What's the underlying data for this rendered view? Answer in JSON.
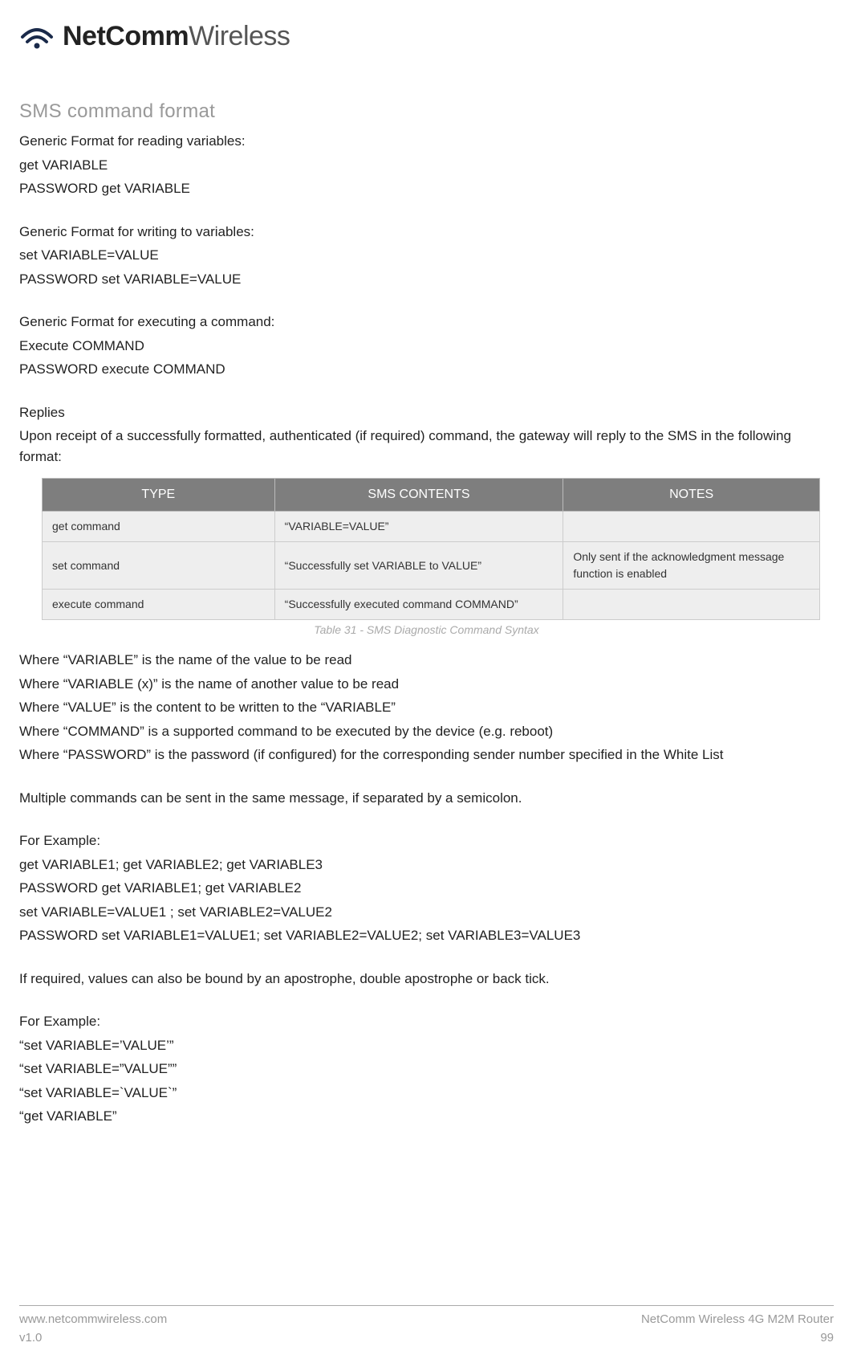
{
  "brand": {
    "bold": "NetComm",
    "thin": "Wireless"
  },
  "heading": "SMS command format",
  "read_intro": "Generic Format for reading variables:",
  "read_1": "get VARIABLE",
  "read_2": "PASSWORD get VARIABLE",
  "write_intro": "Generic Format for writing to variables:",
  "write_1": "set VARIABLE=VALUE",
  "write_2": "PASSWORD set VARIABLE=VALUE",
  "exec_intro": "Generic Format for executing a command:",
  "exec_1": "Execute COMMAND",
  "exec_2": "PASSWORD execute COMMAND",
  "replies_h": "Replies",
  "replies_body": "Upon receipt of a successfully formatted, authenticated (if required) command, the gateway will reply to the SMS in the following format:",
  "table": {
    "headers": [
      "TYPE",
      "SMS CONTENTS",
      "NOTES"
    ],
    "rows": [
      {
        "type": "get command",
        "contents": "“VARIABLE=VALUE”",
        "notes": ""
      },
      {
        "type": "set command",
        "contents": "“Successfully set VARIABLE to VALUE”",
        "notes": "Only sent if the acknowledgment message function is enabled"
      },
      {
        "type": "execute command",
        "contents": "“Successfully executed command COMMAND”",
        "notes": ""
      }
    ],
    "caption": "Table 31 - SMS Diagnostic Command Syntax"
  },
  "where": [
    "Where “VARIABLE” is the name of the value to be read",
    "Where “VARIABLE (x)” is the name of another value to be read",
    "Where “VALUE” is the content to be written to the “VARIABLE”",
    "Where “COMMAND” is a supported command to be executed by the device (e.g. reboot)",
    "Where “PASSWORD” is the password (if configured) for the corresponding sender number specified in the White List"
  ],
  "multi": "Multiple commands can be sent in the same message, if separated by a semicolon.",
  "ex1_h": "For Example:",
  "ex1": [
    "get VARIABLE1; get VARIABLE2; get VARIABLE3",
    "PASSWORD get VARIABLE1; get VARIABLE2",
    "set VARIABLE=VALUE1 ; set VARIABLE2=VALUE2",
    "PASSWORD set VARIABLE1=VALUE1; set VARIABLE2=VALUE2; set VARIABLE3=VALUE3"
  ],
  "bound": "If required, values can also be bound by an apostrophe, double apostrophe or back tick.",
  "ex2_h": "For Example:",
  "ex2": [
    "“set VARIABLE=’VALUE’”",
    "“set VARIABLE=”VALUE””",
    "“set VARIABLE=`VALUE`”",
    "“get VARIABLE”"
  ],
  "footer": {
    "url": "www.netcommwireless.com",
    "ver": "v1.0",
    "product": "NetComm Wireless 4G M2M Router",
    "page": "99"
  }
}
